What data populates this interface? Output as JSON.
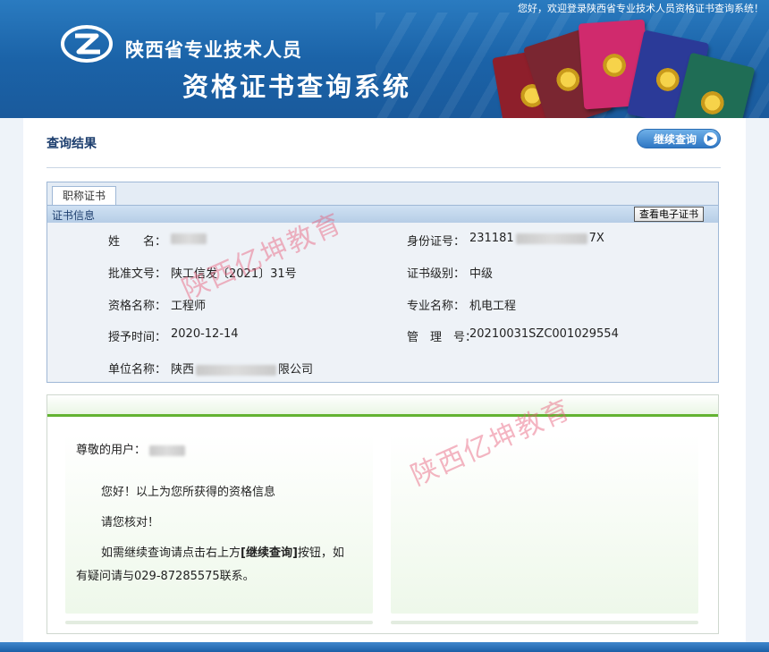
{
  "header": {
    "welcome": "您好，欢迎登录陕西省专业技术人员资格证书查询系统！",
    "title_line1": "陕西省专业技术人员",
    "title_line2": "资格证书查询系统"
  },
  "result": {
    "title": "查询结果",
    "continue_button": "继续查询",
    "tab_label": "职称证书",
    "section_label": "证书信息",
    "ecert_button": "查看电子证书",
    "fields": {
      "name_label": "姓　　名：",
      "id_label": "身份证号：",
      "id_prefix": "231181",
      "id_suffix": "7X",
      "approval_label": "批准文号：",
      "approval_value": "陕工信发〔2021〕31号",
      "level_label": "证书级别：",
      "level_value": "中级",
      "qual_label": "资格名称：",
      "qual_value": "工程师",
      "major_label": "专业名称：",
      "major_value": "机电工程",
      "date_label": "授予时间：",
      "date_value": "2020-12-14",
      "mgmt_label": "管　理　号：",
      "mgmt_value": "20210031SZC001029554",
      "unit_label": "单位名称：",
      "unit_prefix": "陕西",
      "unit_suffix": "限公司"
    }
  },
  "message": {
    "dear": "尊敬的用户：",
    "line1": "您好！以上为您所获得的资格信息",
    "line2": "请您核对！",
    "line3a": "如需继续查询请点击右上方",
    "line3b": "[继续查询]",
    "line3c": "按钮，如",
    "line4": "有疑问请与029-87285575联系。"
  },
  "watermark": "陕西亿坤教育",
  "colors": {
    "header_blue": "#1b63a8",
    "accent_green": "#63b332",
    "watermark": "#e65a78"
  }
}
